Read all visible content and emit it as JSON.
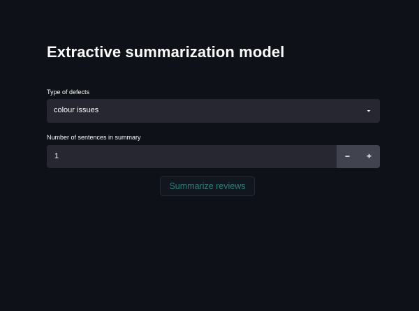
{
  "page": {
    "title": "Extractive summarization model"
  },
  "defect_type": {
    "label": "Type of defects",
    "selected": "colour issues",
    "icon": "chevron-down-icon"
  },
  "sentence_count": {
    "label": "Number of sentences in summary",
    "value": "1",
    "decrement_label": "−",
    "increment_label": "+"
  },
  "actions": {
    "summarize_label": "Summarize reviews"
  },
  "colors": {
    "background": "#0e1117",
    "input_background": "#262730",
    "stepper_background": "#41444e",
    "button_text": "#2f7e7a",
    "text": "#fafafa"
  }
}
